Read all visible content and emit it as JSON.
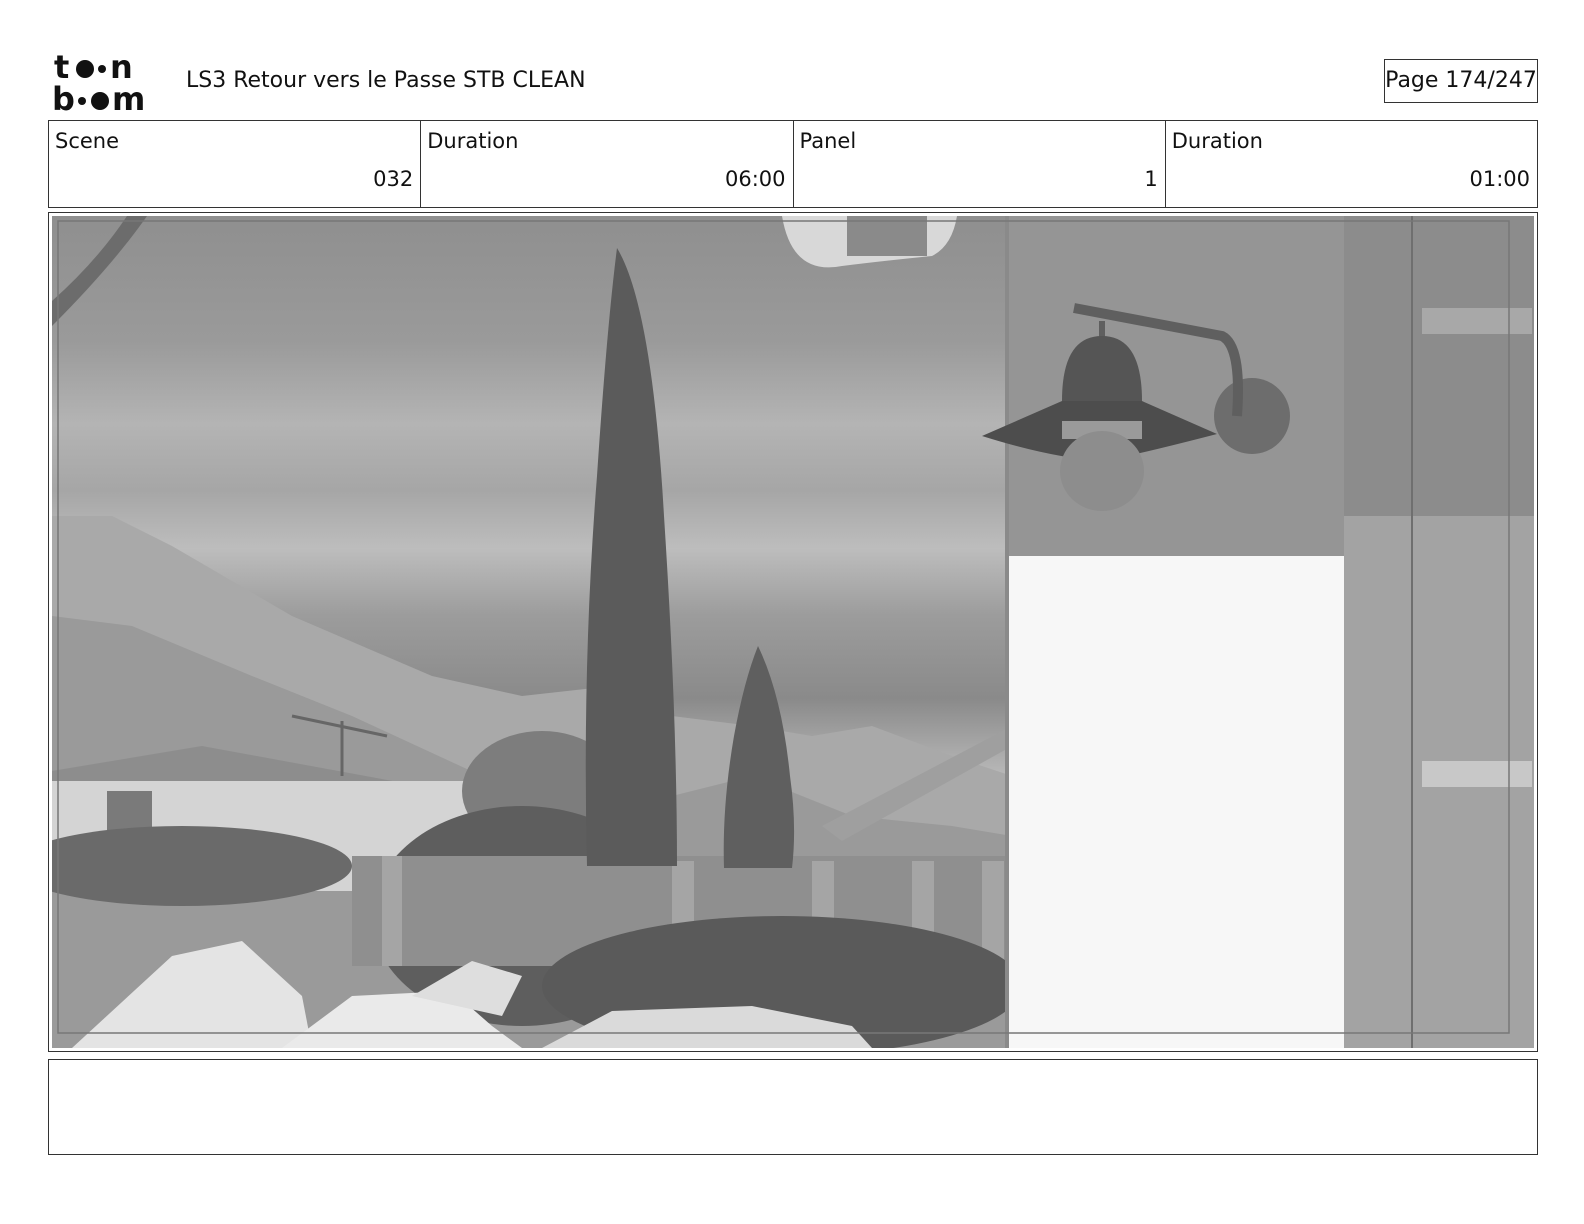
{
  "header": {
    "logo_text": "toonboom",
    "document_title": "LS3 Retour vers le Passe STB CLEAN",
    "page_indicator": "Page 174/247"
  },
  "info": {
    "scene_label": "Scene",
    "scene_value": "032",
    "scene_duration_label": "Duration",
    "scene_duration_value": "06:00",
    "panel_label": "Panel",
    "panel_value": "1",
    "panel_duration_label": "Duration",
    "panel_duration_value": "01:00"
  },
  "notes": {
    "text": ""
  }
}
